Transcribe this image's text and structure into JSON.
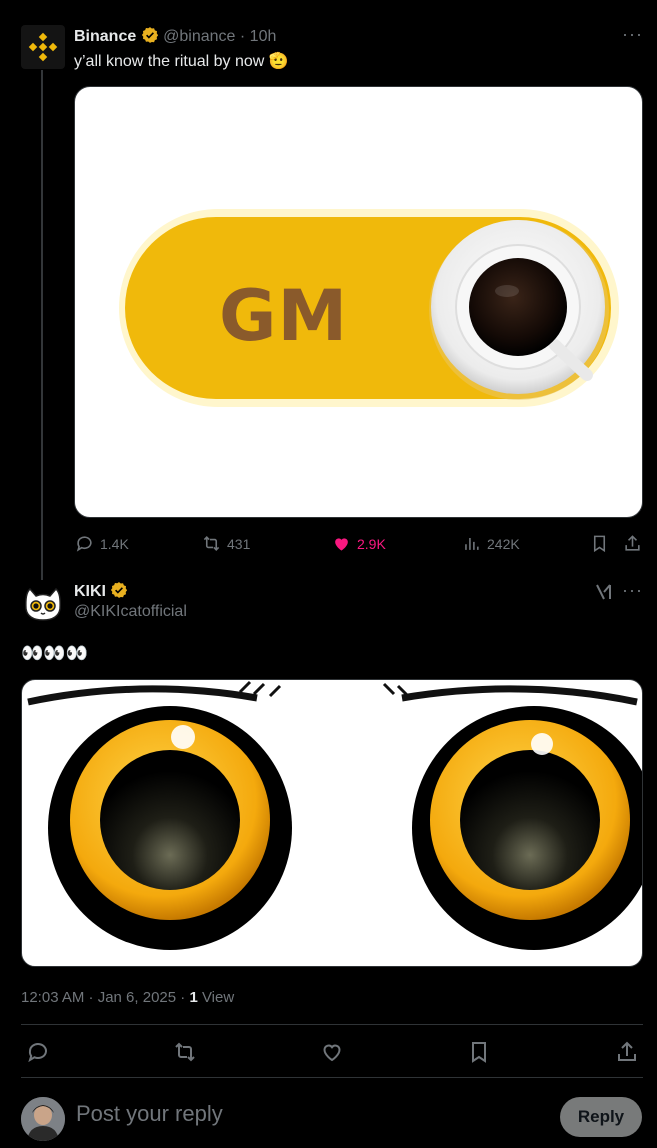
{
  "tweet1": {
    "name": "Binance",
    "handle": "@binance",
    "time": "· 10h",
    "text": "y’all know the ritual by now 🫡",
    "image_text": "GM",
    "stats": {
      "replies": "1.4K",
      "reposts": "431",
      "likes": "2.9K",
      "views": "242K"
    }
  },
  "tweet2": {
    "name": "KIKI",
    "handle": "@KIKIcatofficial",
    "text": "👀👀👀",
    "timestamp": "12:03 AM · Jan 6, 2025 · ",
    "views_count": "1",
    "views_label": " View"
  },
  "reply": {
    "placeholder": "Post your reply",
    "button": "Reply"
  },
  "colors": {
    "background": "#000000",
    "text": "#e7e9ea",
    "muted": "#71767b",
    "like": "#f91880",
    "verified": "#e8b020",
    "binance_yellow": "#f0b90b"
  }
}
